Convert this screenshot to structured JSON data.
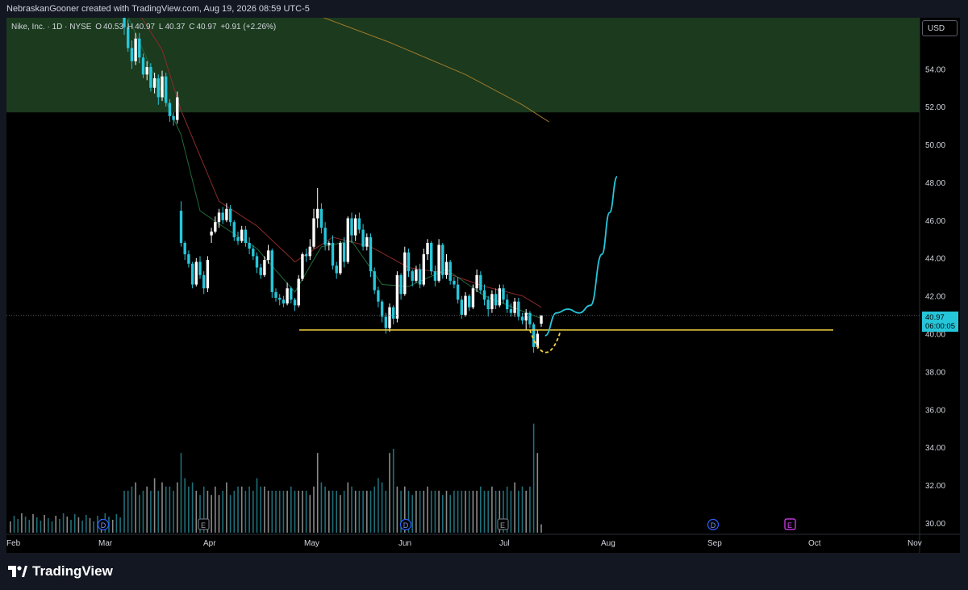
{
  "header": {
    "credit": "NebraskanGooner created with TradingView.com, Aug 19, 2026 08:59 UTC-5"
  },
  "legend": {
    "symbol": "Nike, Inc. · 1D · NYSE",
    "open_label": "O",
    "open": "40.53",
    "high_label": "H",
    "high": "40.97",
    "low_label": "L",
    "low": "40.37",
    "close_label": "C",
    "close": "40.97",
    "change": "+0.91 (+2.26%)"
  },
  "price_scale": {
    "currency": "USD",
    "last_price": "40.97",
    "countdown": "06:00:05",
    "last_price_color": "#26c6da"
  },
  "brand": {
    "name": "TradingView"
  },
  "colors": {
    "up_candle": "#ffffff",
    "down_candle": "#26c6da",
    "support_line": "#f5d442",
    "projection": "#26c6da",
    "resistance_zone": "#1b3a1e",
    "ema_fast": "#1f6b3a",
    "ema_mid": "#8c2a2a",
    "ema_slow": "#a07a2a",
    "earnings_marker": "#e040fb",
    "dividend_marker": "#2962ff"
  },
  "chart_data": {
    "type": "candlestick",
    "title": "Nike, Inc. · 1D · NYSE",
    "y_ticks": [
      30,
      32,
      34,
      36,
      38,
      40,
      42,
      44,
      46,
      48,
      50,
      52,
      54
    ],
    "y_tick_labels": [
      "30.00",
      "32.00",
      "34.00",
      "36.00",
      "38.00",
      "40.00",
      "42.00",
      "44.00",
      "46.00",
      "48.00",
      "50.00",
      "52.00",
      "54.00"
    ],
    "x_tick_labels": [
      "Feb",
      "Mar",
      "Apr",
      "May",
      "Jun",
      "Jul",
      "Aug",
      "Sep",
      "Oct",
      "Nov"
    ],
    "ylim": [
      29.4,
      56.7
    ],
    "resistance_zone": [
      51.7,
      56.7
    ],
    "support_level": 40.2,
    "last_price": 40.97,
    "events": [
      {
        "type": "D",
        "month": "Mar"
      },
      {
        "type": "E",
        "month": "Apr"
      },
      {
        "type": "D",
        "month": "Jun"
      },
      {
        "type": "E",
        "month": "Jul"
      },
      {
        "type": "D",
        "month": "Sep"
      },
      {
        "type": "E",
        "month": "Sep"
      }
    ],
    "candles": [
      [
        57.0,
        57.5,
        55.8,
        56.2
      ],
      [
        56.2,
        56.6,
        54.9,
        55.1
      ],
      [
        55.1,
        55.5,
        54.0,
        54.4
      ],
      [
        54.4,
        55.9,
        54.2,
        55.6
      ],
      [
        55.6,
        55.9,
        54.3,
        54.6
      ],
      [
        54.6,
        54.8,
        53.5,
        53.7
      ],
      [
        53.7,
        54.4,
        53.4,
        54.1
      ],
      [
        54.1,
        54.3,
        52.8,
        53.0
      ],
      [
        53.0,
        53.8,
        52.7,
        53.5
      ],
      [
        53.5,
        53.7,
        52.1,
        52.5
      ],
      [
        52.5,
        53.9,
        52.3,
        53.6
      ],
      [
        53.6,
        53.8,
        52.0,
        52.2
      ],
      [
        52.2,
        52.4,
        51.2,
        51.5
      ],
      [
        51.5,
        51.7,
        51.0,
        51.3
      ],
      [
        51.3,
        52.8,
        51.1,
        52.5
      ],
      [
        46.5,
        47.0,
        44.6,
        44.8
      ],
      [
        44.8,
        44.9,
        43.9,
        44.2
      ],
      [
        44.2,
        44.4,
        43.5,
        43.7
      ],
      [
        43.7,
        43.8,
        42.4,
        42.6
      ],
      [
        42.6,
        44.0,
        42.5,
        43.8
      ],
      [
        43.8,
        44.1,
        42.9,
        43.1
      ],
      [
        43.1,
        43.3,
        42.1,
        42.4
      ],
      [
        42.4,
        44.1,
        42.2,
        43.9
      ],
      [
        45.2,
        45.6,
        44.8,
        45.4
      ],
      [
        45.4,
        46.2,
        45.3,
        45.9
      ],
      [
        45.9,
        46.6,
        45.6,
        46.4
      ],
      [
        46.4,
        46.7,
        45.8,
        46.0
      ],
      [
        46.0,
        46.9,
        45.9,
        46.6
      ],
      [
        46.6,
        46.8,
        45.7,
        45.9
      ],
      [
        45.9,
        46.0,
        44.9,
        45.1
      ],
      [
        45.1,
        45.4,
        44.7,
        44.9
      ],
      [
        44.9,
        45.7,
        44.8,
        45.5
      ],
      [
        45.5,
        45.7,
        44.6,
        44.8
      ],
      [
        44.8,
        45.1,
        44.2,
        44.5
      ],
      [
        44.5,
        44.7,
        43.9,
        44.1
      ],
      [
        44.1,
        44.3,
        43.2,
        43.5
      ],
      [
        43.5,
        43.7,
        42.9,
        43.1
      ],
      [
        43.1,
        44.1,
        43.0,
        43.9
      ],
      [
        43.9,
        44.7,
        43.7,
        44.4
      ],
      [
        44.4,
        44.5,
        41.9,
        42.2
      ],
      [
        42.2,
        42.4,
        41.7,
        41.9
      ],
      [
        41.9,
        42.1,
        41.5,
        41.8
      ],
      [
        41.8,
        42.0,
        41.4,
        41.6
      ],
      [
        41.6,
        42.7,
        41.5,
        42.4
      ],
      [
        42.4,
        42.5,
        41.6,
        41.8
      ],
      [
        41.8,
        41.9,
        41.2,
        41.5
      ],
      [
        41.5,
        43.1,
        41.4,
        42.9
      ],
      [
        42.9,
        44.3,
        42.8,
        44.2
      ],
      [
        44.2,
        44.5,
        43.8,
        44.1
      ],
      [
        44.1,
        45.0,
        43.9,
        44.6
      ],
      [
        44.6,
        46.6,
        44.5,
        46.1
      ],
      [
        46.1,
        47.7,
        45.6,
        46.6
      ],
      [
        46.6,
        46.9,
        45.3,
        45.6
      ],
      [
        45.6,
        45.9,
        44.4,
        44.7
      ],
      [
        44.7,
        44.9,
        44.4,
        44.8
      ],
      [
        44.8,
        45.2,
        43.4,
        43.6
      ],
      [
        43.6,
        43.8,
        42.9,
        43.2
      ],
      [
        43.2,
        44.9,
        43.1,
        44.8
      ],
      [
        44.8,
        45.1,
        43.5,
        43.8
      ],
      [
        43.8,
        46.2,
        43.7,
        46.1
      ],
      [
        46.1,
        46.4,
        44.8,
        45.2
      ],
      [
        45.2,
        46.3,
        44.9,
        46.1
      ],
      [
        46.1,
        46.4,
        45.3,
        45.5
      ],
      [
        45.5,
        45.8,
        44.4,
        44.6
      ],
      [
        44.6,
        45.3,
        44.4,
        45.1
      ],
      [
        45.1,
        45.3,
        43.0,
        43.3
      ],
      [
        43.3,
        43.5,
        42.1,
        42.3
      ],
      [
        42.3,
        42.5,
        41.4,
        41.7
      ],
      [
        41.7,
        41.8,
        40.6,
        40.9
      ],
      [
        40.9,
        41.1,
        40.0,
        40.3
      ],
      [
        40.3,
        41.6,
        40.1,
        41.4
      ],
      [
        41.4,
        41.5,
        40.5,
        40.8
      ],
      [
        40.8,
        43.3,
        40.6,
        43.1
      ],
      [
        43.1,
        43.2,
        41.8,
        42.1
      ],
      [
        42.1,
        44.6,
        42.0,
        44.3
      ],
      [
        44.3,
        44.5,
        43.0,
        43.3
      ],
      [
        43.3,
        43.4,
        42.5,
        42.8
      ],
      [
        42.8,
        43.6,
        42.7,
        43.4
      ],
      [
        43.4,
        43.7,
        42.4,
        42.6
      ],
      [
        42.6,
        44.5,
        42.5,
        44.2
      ],
      [
        44.2,
        45.0,
        43.9,
        44.8
      ],
      [
        44.8,
        44.9,
        43.1,
        43.3
      ],
      [
        43.3,
        43.6,
        42.5,
        42.8
      ],
      [
        42.8,
        45.0,
        42.7,
        44.7
      ],
      [
        44.7,
        44.8,
        42.9,
        43.1
      ],
      [
        43.1,
        44.2,
        42.9,
        43.8
      ],
      [
        43.8,
        43.9,
        42.6,
        42.8
      ],
      [
        42.8,
        43.0,
        42.4,
        42.6
      ],
      [
        42.6,
        43.0,
        41.6,
        41.8
      ],
      [
        41.8,
        42.0,
        40.8,
        41.0
      ],
      [
        41.0,
        42.2,
        40.9,
        42.0
      ],
      [
        42.0,
        42.1,
        41.2,
        41.4
      ],
      [
        41.4,
        42.6,
        41.3,
        42.4
      ],
      [
        42.4,
        43.4,
        42.2,
        43.1
      ],
      [
        43.1,
        43.3,
        42.1,
        42.3
      ],
      [
        42.3,
        42.6,
        41.5,
        41.8
      ],
      [
        41.8,
        42.0,
        40.9,
        41.3
      ],
      [
        41.3,
        42.3,
        41.1,
        42.1
      ],
      [
        42.1,
        42.4,
        41.3,
        41.5
      ],
      [
        41.5,
        42.6,
        41.4,
        42.4
      ],
      [
        42.4,
        42.6,
        41.6,
        41.8
      ],
      [
        41.8,
        42.1,
        41.1,
        41.3
      ],
      [
        41.3,
        41.6,
        40.9,
        41.1
      ],
      [
        41.1,
        41.9,
        40.9,
        41.7
      ],
      [
        41.7,
        41.9,
        40.7,
        40.9
      ],
      [
        40.9,
        41.1,
        40.5,
        40.7
      ],
      [
        40.7,
        41.3,
        40.2,
        41.1
      ],
      [
        41.1,
        41.2,
        40.3,
        40.5
      ],
      [
        40.5,
        40.6,
        39.0,
        39.3
      ],
      [
        39.3,
        40.2,
        39.2,
        40.0
      ],
      [
        40.53,
        40.97,
        40.37,
        40.97
      ]
    ],
    "volumes": [
      1.0,
      1.0,
      1.1,
      1.2,
      0.9,
      1.0,
      1.1,
      1.0,
      1.3,
      1.0,
      1.2,
      1.1,
      1.1,
      1.0,
      1.2,
      1.9,
      1.3,
      1.1,
      1.2,
      1.0,
      0.9,
      1.1,
      1.0,
      0.9,
      1.1,
      0.9,
      1.0,
      1.2,
      0.9,
      1.0,
      1.1,
      1.1,
      1.0,
      1.1,
      1.0,
      1.3,
      1.1,
      1.1,
      1.0,
      1.0,
      1.0,
      1.0,
      1.0,
      1.0,
      1.1,
      1.0,
      1.0,
      1.0,
      1.0,
      0.9,
      1.1,
      1.9,
      1.2,
      1.1,
      1.0,
      1.0,
      1.0,
      0.9,
      1.0,
      1.2,
      1.1,
      1.0,
      1.0,
      1.0,
      1.0,
      1.0,
      1.1,
      1.3,
      1.2,
      1.0,
      1.9,
      2.0,
      1.1,
      1.0,
      1.1,
      1.0,
      0.9,
      1.0,
      1.0,
      1.0,
      1.1,
      1.0,
      1.0,
      1.0,
      0.9,
      1.0,
      0.9,
      1.0,
      1.0,
      1.0,
      1.0,
      1.0,
      1.0,
      1.0,
      1.1,
      1.0,
      1.0,
      1.1,
      1.0,
      1.0,
      1.0,
      1.1,
      1.0,
      1.2,
      1.0,
      1.1,
      1.0,
      1.1,
      2.6,
      1.9,
      0.2
    ],
    "ema_fast": [
      [
        0,
        57.2
      ],
      [
        15,
        50.5
      ],
      [
        20,
        46.5
      ],
      [
        25,
        45.8
      ],
      [
        35,
        44.5
      ],
      [
        45,
        42.2
      ],
      [
        52,
        44.6
      ],
      [
        60,
        44.9
      ],
      [
        68,
        42.6
      ],
      [
        75,
        42.5
      ],
      [
        85,
        43.4
      ],
      [
        95,
        42.0
      ],
      [
        105,
        41.2
      ],
      [
        110,
        40.8
      ]
    ],
    "ema_mid": [
      [
        3,
        57.2
      ],
      [
        10,
        55.0
      ],
      [
        15,
        51.8
      ],
      [
        25,
        47.0
      ],
      [
        35,
        45.7
      ],
      [
        45,
        43.8
      ],
      [
        55,
        45.1
      ],
      [
        65,
        44.6
      ],
      [
        75,
        43.5
      ],
      [
        85,
        43.2
      ],
      [
        95,
        42.5
      ],
      [
        105,
        42.0
      ],
      [
        110,
        41.4
      ]
    ],
    "ema_slow": [
      [
        50,
        56.9
      ],
      [
        70,
        55.4
      ],
      [
        90,
        53.7
      ],
      [
        105,
        52.1
      ],
      [
        112,
        51.2
      ]
    ],
    "projection": [
      [
        111,
        39.9
      ],
      [
        114,
        41.1
      ],
      [
        117,
        41.3
      ],
      [
        120,
        41.1
      ],
      [
        123,
        41.5
      ],
      [
        126,
        44.2
      ],
      [
        128,
        46.4
      ],
      [
        130,
        48.3
      ]
    ],
    "dip_curve": [
      [
        107,
        40.2
      ],
      [
        110,
        38.7
      ],
      [
        113,
        39.0
      ],
      [
        115,
        40.1
      ]
    ]
  }
}
